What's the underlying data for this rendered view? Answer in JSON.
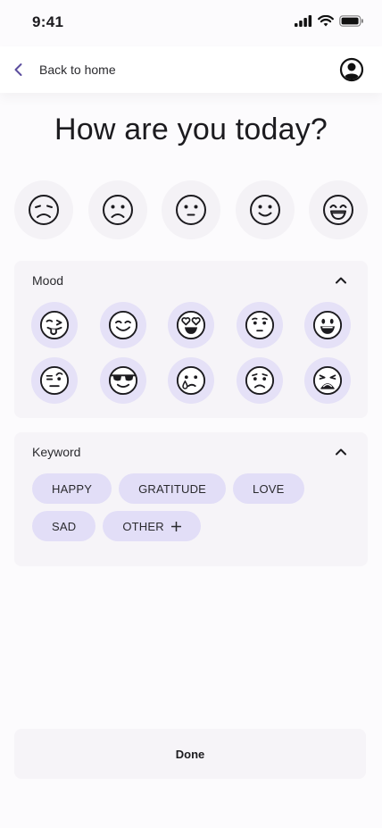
{
  "status": {
    "time": "9:41",
    "icons": [
      "signal-icon",
      "wifi-icon",
      "battery-icon"
    ]
  },
  "nav": {
    "back_label": "Back to home",
    "back_icon": "chevron-left-icon",
    "profile_icon": "profile-icon",
    "accent": "#5b4d9e"
  },
  "title": "How are you today?",
  "top_faces": [
    "tired-face",
    "sad-face",
    "neutral-face",
    "smiling-face",
    "grinning-face"
  ],
  "mood": {
    "header": "Mood",
    "collapse_icon": "chevron-up-icon",
    "faces": [
      "tongue-out-face",
      "blushing-smile-face",
      "heart-eyes-face",
      "hushed-face",
      "big-smile-face",
      "raised-eyebrow-face",
      "sunglasses-face",
      "crying-face",
      "worried-face",
      "weary-face"
    ]
  },
  "keyword": {
    "header": "Keyword",
    "collapse_icon": "chevron-up-icon",
    "chips": [
      "HAPPY",
      "GRATITUDE",
      "LOVE",
      "SAD",
      "OTHER"
    ],
    "other_icon": "plus-icon"
  },
  "done_label": "Done",
  "colors": {
    "background": "#fcfbfd",
    "panel": "#f6f4f8",
    "chip": "#e2def7",
    "mood_circle": "#e5e1f7"
  }
}
